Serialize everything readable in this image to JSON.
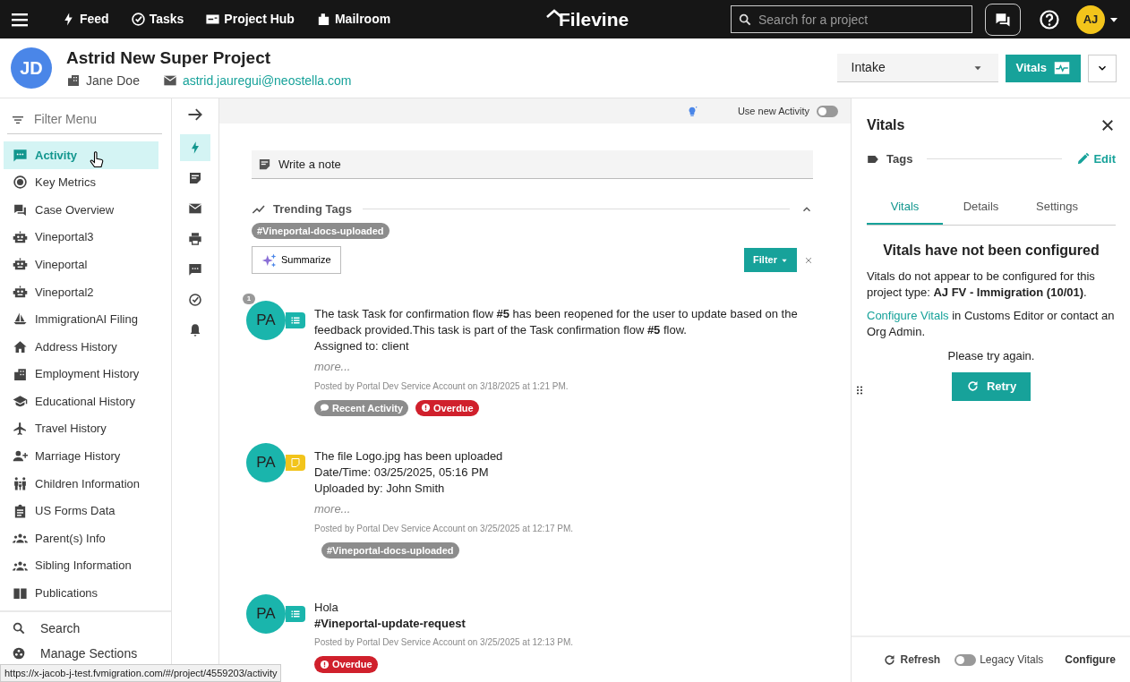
{
  "topnav": {
    "nav_items": [
      {
        "label": "Feed"
      },
      {
        "label": "Tasks"
      },
      {
        "label": "Project Hub"
      },
      {
        "label": "Mailroom"
      }
    ],
    "logo": "Filevine",
    "search": {
      "placeholder": "Search for a project"
    },
    "user_initials": "AJ"
  },
  "project": {
    "avatar": "JD",
    "title": "Astrid New Super Project",
    "owner": "Jane Doe",
    "email": "astrid.jauregui@neostella.com",
    "phase": "Intake",
    "vitals_button": "Vitals"
  },
  "menu": {
    "filter_placeholder": "Filter Menu",
    "items": [
      {
        "label": "Activity",
        "selected": true
      },
      {
        "label": "Key Metrics",
        "selected": false
      },
      {
        "label": "Case Overview",
        "selected": false
      },
      {
        "label": "Vineportal3",
        "selected": false
      },
      {
        "label": "Vineportal",
        "selected": false
      },
      {
        "label": "Vineportal2",
        "selected": false
      },
      {
        "label": "ImmigrationAI Filing",
        "selected": false
      },
      {
        "label": "Address History",
        "selected": false
      },
      {
        "label": "Employment History",
        "selected": false
      },
      {
        "label": "Educational History",
        "selected": false
      },
      {
        "label": "Travel History",
        "selected": false
      },
      {
        "label": "Marriage History",
        "selected": false
      },
      {
        "label": "Children Information",
        "selected": false
      },
      {
        "label": "US Forms Data",
        "selected": false
      },
      {
        "label": "Parent(s) Info",
        "selected": false
      },
      {
        "label": "Sibling Information",
        "selected": false
      },
      {
        "label": "Publications",
        "selected": false
      }
    ],
    "footer": [
      {
        "label": "Search"
      },
      {
        "label": "Manage Sections"
      }
    ]
  },
  "rail": [
    {
      "selected": true
    },
    {
      "selected": false
    },
    {
      "selected": false
    },
    {
      "selected": false
    },
    {
      "selected": false
    },
    {
      "selected": false
    },
    {
      "selected": false
    }
  ],
  "feed": {
    "toggle_label": "Use new Activity",
    "toggle_on": false,
    "note_placeholder": "Write a note",
    "trending_title": "Trending Tags",
    "trending_tags": [
      "#Vineportal-docs-uploaded"
    ],
    "summarize": "Summarize",
    "filter": "Filter",
    "entries": [
      {
        "avatar": "PA",
        "kind": "task",
        "comments": "1",
        "body": "The task Task for confirmation flow **#5** has been reopened for the user to update based on the feedback provided.This task is part of the Task confirmation flow **#5** flow.\nAssigned to: client",
        "more": "more...",
        "posted": "Posted by Portal Dev Service Account on 3/18/2025 at 1:21 PM.",
        "tags": [
          {
            "kind": "activity",
            "label": "Recent Activity"
          },
          {
            "kind": "overdue",
            "label": "Overdue"
          }
        ]
      },
      {
        "avatar": "PA",
        "kind": "file",
        "body": "The file Logo.jpg has been uploaded\nDate/Time: 03/25/2025, 05:16 PM\nUploaded by: John Smith",
        "more": "more...",
        "posted": "Posted by Portal Dev Service Account on 3/25/2025 at 12:17 PM.",
        "tags": [
          {
            "kind": "hashtag",
            "label": "#Vineportal-docs-uploaded"
          }
        ]
      },
      {
        "avatar": "PA",
        "kind": "task",
        "body": "Hola\n**#Vineportal-update-request**",
        "posted": "Posted by Portal Dev Service Account on 3/25/2025 at 12:13 PM.",
        "tags": [
          {
            "kind": "overdue",
            "label": "Overdue"
          }
        ]
      }
    ]
  },
  "vitals": {
    "title": "Vitals",
    "tags_label": "Tags",
    "edit": "Edit",
    "tabs": [
      {
        "label": "Vitals",
        "selected": true
      },
      {
        "label": "Details",
        "selected": false
      },
      {
        "label": "Settings",
        "selected": false
      }
    ],
    "heading": "Vitals have not been configured",
    "message": "Vitals do not appear to be configured for this project type: **AJ FV - Immigration (10/01)**.",
    "link": "Configure Vitals",
    "link_rest": " in Customs Editor or contact an Org Admin.",
    "retry_prompt": "Please try again.",
    "retry": "Retry",
    "footer": {
      "refresh": "Refresh",
      "legacy_label": "Legacy Vitals",
      "legacy_on": false,
      "configure": "Configure"
    }
  },
  "status_url": "https://x-jacob-j-test.fvmigration.com/#/project/4559203/activity"
}
